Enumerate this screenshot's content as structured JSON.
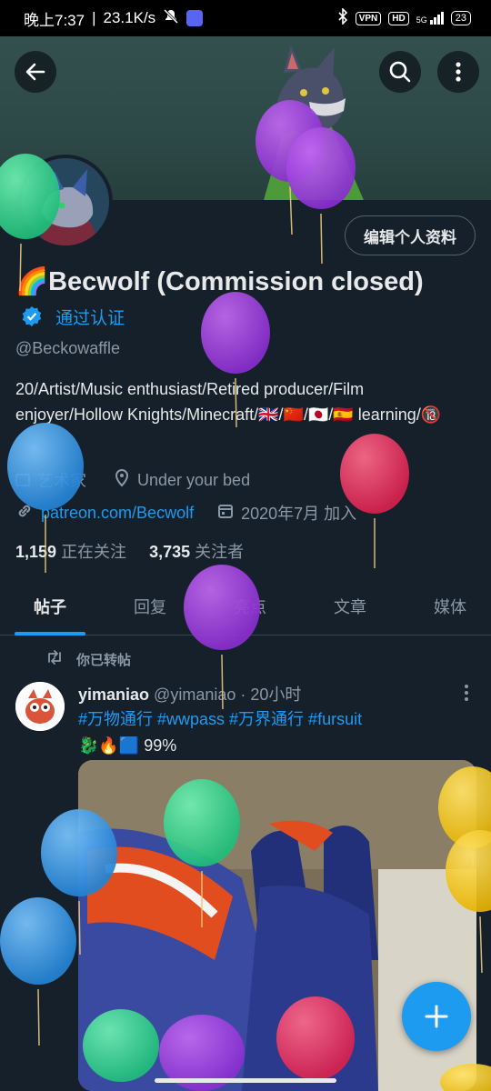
{
  "status_bar": {
    "time": "晚上7:37",
    "speed": "23.1K/s",
    "vpn": "VPN",
    "hd": "HD",
    "network": "5G",
    "battery": "23"
  },
  "header": {
    "back_icon": "arrow-left-icon",
    "search_icon": "search-icon",
    "more_icon": "more-vertical-icon"
  },
  "profile": {
    "edit_label": "编辑个人资料",
    "name": "🌈Becwolf (Commission closed)",
    "verified_label": "通过认证",
    "handle": "@Beckowaffle",
    "bio": "20/Artist/Music enthusiast/Retired producer/Film enjoyer/Hollow Knights/Minecraft/🇬🇧/🇨🇳/🇯🇵/🇪🇸 learning/🔞",
    "category": "艺术家",
    "location": "Under your bed",
    "link": "patreon.com/Becwolf",
    "joined": "2020年7月 加入",
    "following_count": "1,159",
    "following_label": "正在关注",
    "followers_count": "3,735",
    "followers_label": "关注者"
  },
  "tabs": [
    {
      "label": "帖子",
      "active": true
    },
    {
      "label": "回复",
      "active": false
    },
    {
      "label": "亮点",
      "active": false
    },
    {
      "label": "文章",
      "active": false
    },
    {
      "label": "媒体",
      "active": false
    }
  ],
  "post": {
    "repost_label": "你已转帖",
    "author_name": "yimaniao",
    "author_handle": "@yimaniao",
    "time": "· 20小时",
    "hashtags": "#万物通行 #wwpass #万界通行 #fursuit",
    "text_line": "🐉🔥🟦 99%"
  },
  "fab_icon": "plus-icon",
  "colors": {
    "background": "#15202b",
    "accent": "#1d9bf0",
    "muted_text": "#8b98a5"
  }
}
